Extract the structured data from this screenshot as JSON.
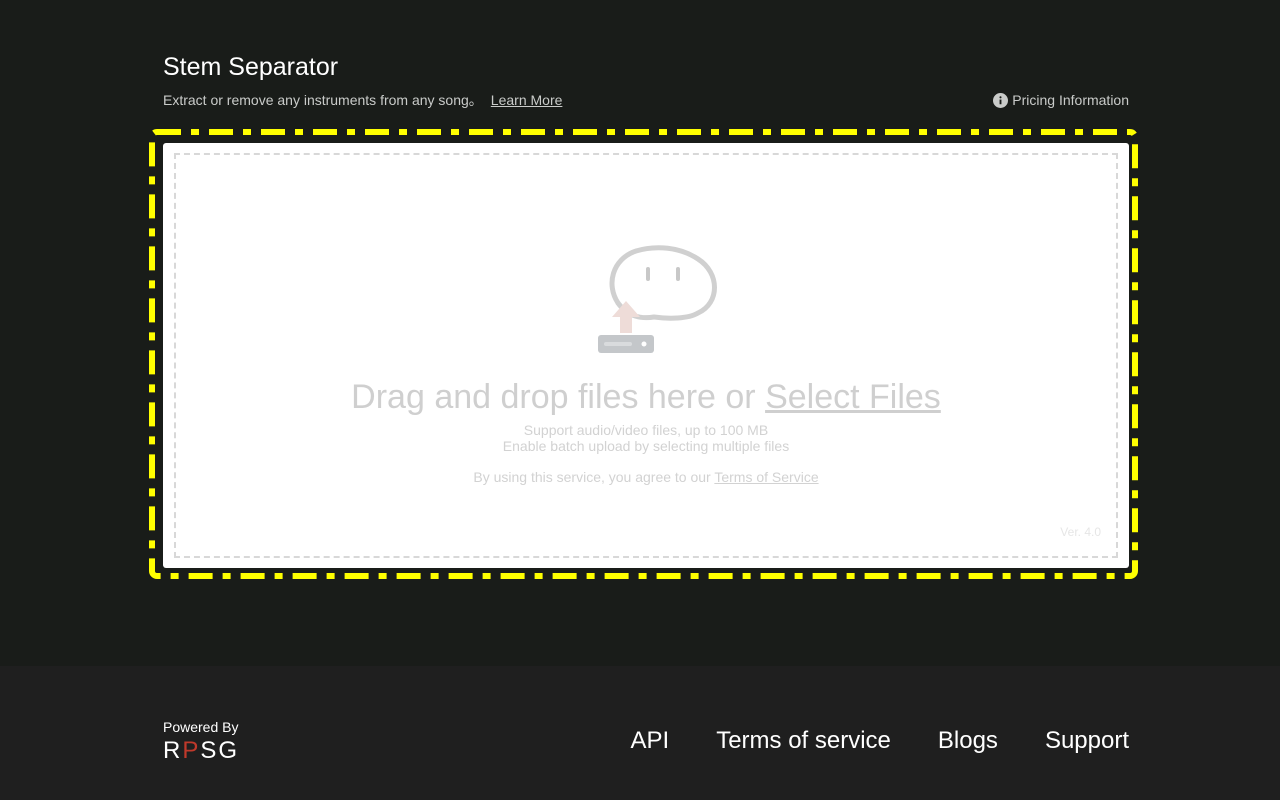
{
  "header": {
    "title": "Stem Separator",
    "subtitle": "Extract or remove any instruments from any song。",
    "learn_more": "Learn More",
    "pricing": "Pricing Information",
    "pricing_icon": "info-icon"
  },
  "dropzone": {
    "icon": "upload-cloud-icon",
    "drag_text": "Drag and drop files here or ",
    "select_files": "Select Files",
    "support_line1": "Support audio/video files, up to 100 MB",
    "support_line2": "Enable batch upload by selecting multiple files",
    "agree_text": "By using this service, you agree to our ",
    "terms_link": "Terms of Service",
    "version": "Ver. 4.0"
  },
  "footer": {
    "powered_by": "Powered By",
    "logo_r": "R",
    "logo_p": "P",
    "logo_sg": "SG",
    "links": [
      "API",
      "Terms of service",
      "Blogs",
      "Support"
    ]
  },
  "colors": {
    "background": "#191c19",
    "footer_bg": "#1f1f1f",
    "highlight": "#ffff00",
    "logo_accent": "#c0392b"
  }
}
